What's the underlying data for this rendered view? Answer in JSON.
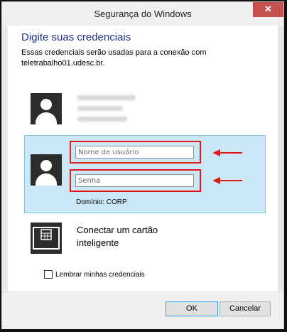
{
  "window": {
    "title": "Segurança do Windows",
    "close_glyph": "✕"
  },
  "dialog": {
    "heading": "Digite suas credenciais",
    "description_line1": "Essas credenciais serão usadas para a conexão com",
    "description_line2": "teletrabalho01.udesc.br."
  },
  "credentials": {
    "username_placeholder": "Nome de usuário",
    "password_placeholder": "Senha",
    "domain": "Domínio: CORP"
  },
  "smartcard": {
    "label_line1": "Conectar um cartão",
    "label_line2": "inteligente"
  },
  "remember": {
    "label": "Lembrar minhas credenciais"
  },
  "buttons": {
    "ok": "OK",
    "cancel": "Cancelar"
  },
  "colors": {
    "accent": "#1e3287",
    "selection": "#cbe8f6",
    "highlight_annotation": "#e41a1a",
    "close": "#c75050"
  },
  "icons": {
    "user": "user-avatar-icon",
    "smartcard": "smartcard-icon",
    "annotation": "red-arrow-icon"
  }
}
